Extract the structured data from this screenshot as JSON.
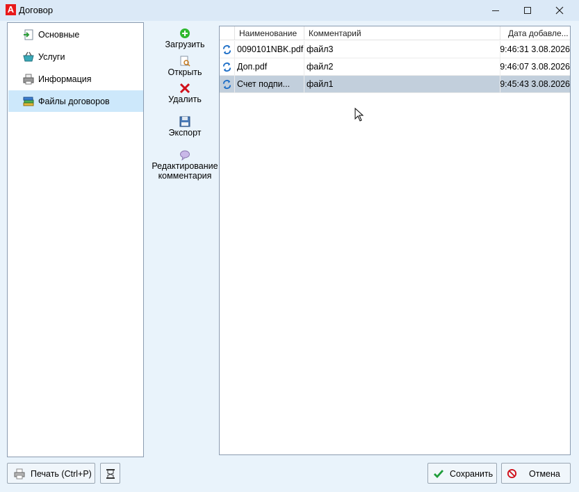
{
  "window": {
    "logo_letter": "A",
    "title": "Договор"
  },
  "nav": {
    "items": [
      {
        "label": "Основные",
        "icon": "document-arrow-icon"
      },
      {
        "label": "Услуги",
        "icon": "basket-icon"
      },
      {
        "label": "Информация",
        "icon": "printer-info-icon"
      },
      {
        "label": "Файлы договоров",
        "icon": "books-icon",
        "selected": true
      }
    ]
  },
  "toolbar": {
    "upload": "Загрузить",
    "open": "Открыть",
    "delete": "Удалить",
    "export": "Экспорт",
    "edit_comment_line1": "Редактирование",
    "edit_comment_line2": "комментария"
  },
  "grid": {
    "columns": [
      "Наименование",
      "Комментарий",
      "Дата добавле..."
    ],
    "rows": [
      {
        "name": "0090101NBK.pdf",
        "comment": "файл3",
        "date": "3.08.2026 9:46:31",
        "selected": false
      },
      {
        "name": "Доп.pdf",
        "comment": "файл2",
        "date": "3.08.2026 9:46:07",
        "selected": false
      },
      {
        "name": "Счет подписанный.pdf",
        "name_display": "Счет подпи...",
        "comment": "файл1",
        "date": "3.08.2026 9:45:43",
        "selected": true
      }
    ]
  },
  "footer": {
    "print": "Печать (Ctrl+P)",
    "save": "Сохранить",
    "cancel": "Отмена"
  },
  "colors": {
    "window_bg": "#e9f3fb",
    "selection": "#cde8fb",
    "row_selection": "#c2cfdc",
    "add_green": "#2eb82e",
    "delete_red": "#d0101a"
  }
}
